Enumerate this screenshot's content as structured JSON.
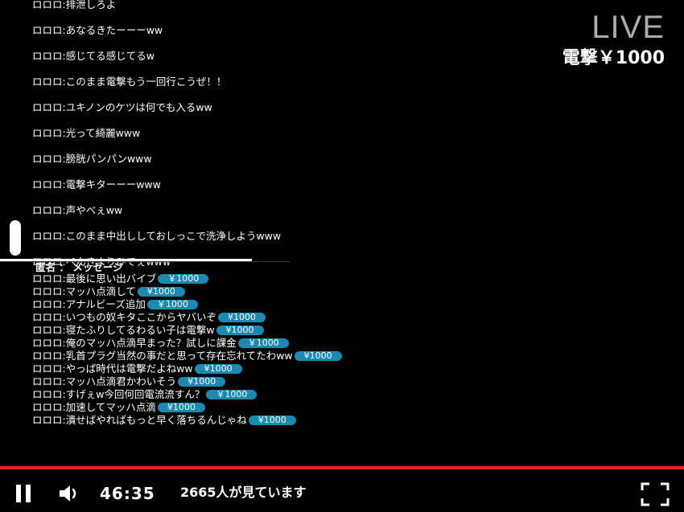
{
  "live": {
    "title": "LIVE",
    "amount": "電撃￥1000"
  },
  "chat_top": [
    "ロロロ:排泄しろよ",
    "ロロロ:あなるきたーーーww",
    "ロロロ:感じてる感じてるw",
    "ロロロ:このまま電撃もう一回行こうぜ！！",
    "ロロロ:ユキノンのケツは何でも入るww",
    "ロロロ:光って綺麗www",
    "ロロロ:膀胱パンパンwww",
    "ロロロ:電撃キターーーwww",
    "ロロロ:声やべぇww",
    "ロロロ:このまま中出ししておしっこで洗浄しようwww",
    "ロロロ:ぺんきよりひでぇwww"
  ],
  "super_header": "匿名 ： メッセージ",
  "super_chats": [
    {
      "text": "ロロロ:最後に思い出バイブ",
      "amount": "￥1000"
    },
    {
      "text": "ロロロ:マッハ点滴して",
      "amount": "¥1000"
    },
    {
      "text": "ロロロ:アナルビーズ追加",
      "amount": "￥1000"
    },
    {
      "text": "ロロロ:いつもの奴キタここからヤバいぞ",
      "amount": "¥1000"
    },
    {
      "text": "ロロロ:寝たふりしてるわるい子は電撃w",
      "amount": "¥1000"
    },
    {
      "text": "ロロロ:俺のマッハ点滴早まった？試しに課金",
      "amount": "￥1000"
    },
    {
      "text": "ロロロ:乳首プラグ当然の事だと思って存在忘れてたわww",
      "amount": "¥1000"
    },
    {
      "text": "ロロロ:やっぱ時代は電撃だよねww",
      "amount": "¥1000"
    },
    {
      "text": "ロロロ:マッハ点滴君かわいそう",
      "amount": "¥1000"
    },
    {
      "text": "ロロロ:すげぇw今回何回電流流すん？",
      "amount": "￥1000"
    },
    {
      "text": "ロロロ:加速してマッハ点滴",
      "amount": "¥1000"
    },
    {
      "text": "ロロロ:潰せばやればもっと早く落ちるんじゃね",
      "amount": "¥1000"
    }
  ],
  "player": {
    "time": "46:35",
    "viewers": "2665人が見ています",
    "progress_color": "#d9261c",
    "pill_color": "#1a8ab2",
    "icons": [
      "pause-icon",
      "volume-icon",
      "fullscreen-icon"
    ]
  }
}
